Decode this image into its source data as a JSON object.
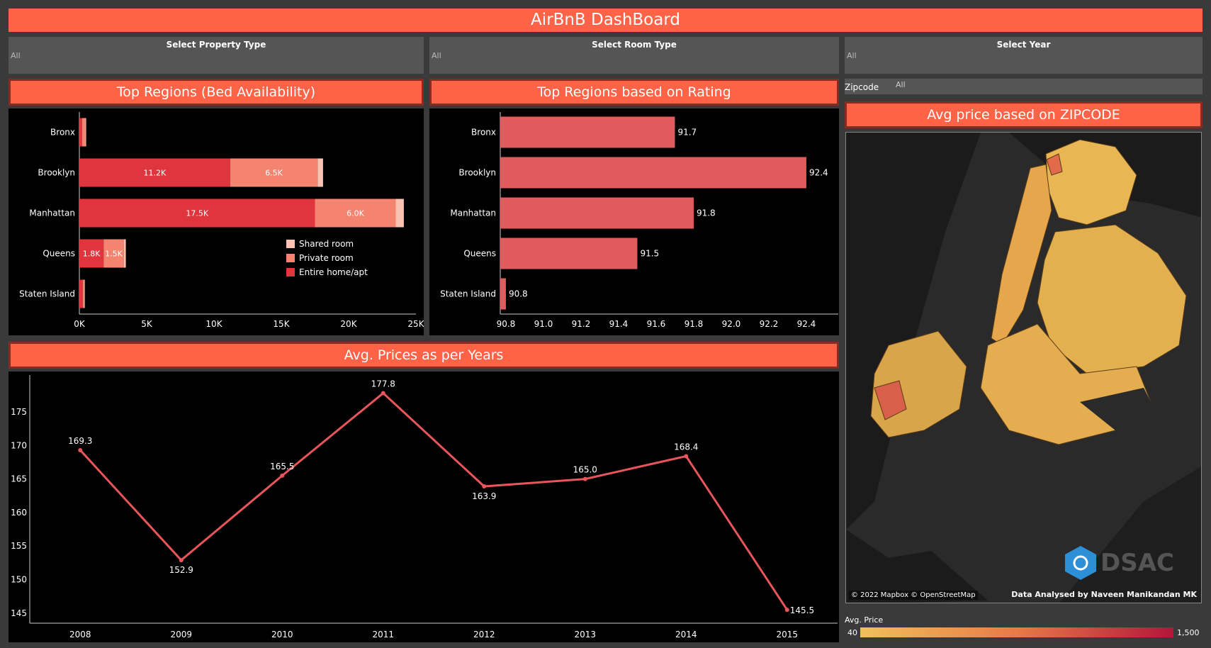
{
  "dashboard": {
    "title": "AirBnB DashBoard"
  },
  "filters": [
    {
      "label": "Select Property Type",
      "value": "All"
    },
    {
      "label": "Select Room Type",
      "value": "All"
    },
    {
      "label": "Select Year",
      "value": "All"
    }
  ],
  "zipcode_filter": {
    "label": "Zipcode",
    "value": "All"
  },
  "panels": {
    "beds": "Top Regions (Bed Availability)",
    "rating": "Top Regions based on Rating",
    "years": "Avg. Prices as per Years",
    "map": "Avg price based on ZIPCODE"
  },
  "map": {
    "attribution": "© 2022 Mapbox © OpenStreetMap",
    "credit": "Data Analysed by Naveen Manikandan MK",
    "logo_text": "DSAC",
    "legend_title": "Avg. Price",
    "legend_min": "40",
    "legend_max": "1,500",
    "colors": {
      "low": "#f0c05a",
      "high": "#b3163a",
      "water": "#2b2b2b",
      "land": "#1e1e1e"
    }
  },
  "chart_data": [
    {
      "type": "bar",
      "stacked": true,
      "orientation": "horizontal",
      "title": "Top Regions (Bed Availability)",
      "categories": [
        "Bronx",
        "Brooklyn",
        "Manhattan",
        "Queens",
        "Staten Island"
      ],
      "series": [
        {
          "name": "Entire home/apt",
          "color": "#e0353d",
          "values": [
            200,
            11200,
            17500,
            1800,
            250
          ]
        },
        {
          "name": "Private room",
          "color": "#f4836f",
          "values": [
            250,
            6500,
            6000,
            1500,
            100
          ]
        },
        {
          "name": "Shared room",
          "color": "#fcc2b1",
          "values": [
            50,
            400,
            600,
            150,
            20
          ]
        }
      ],
      "data_labels": [
        [
          "",
          "",
          ""
        ],
        [
          "11.2K",
          "6.5K",
          ""
        ],
        [
          "17.5K",
          "6.0K",
          ""
        ],
        [
          "1.8K",
          "1.5K",
          ""
        ],
        [
          "",
          "",
          ""
        ]
      ],
      "xticks": [
        "0K",
        "5K",
        "10K",
        "15K",
        "20K",
        "25K"
      ],
      "xlim": [
        0,
        25000
      ],
      "legend_position": "inside-right",
      "legend": [
        "Shared room",
        "Private room",
        "Entire home/apt"
      ]
    },
    {
      "type": "bar",
      "orientation": "horizontal",
      "title": "Top Regions based on Rating",
      "categories": [
        "Bronx",
        "Brooklyn",
        "Manhattan",
        "Queens",
        "Staten Island"
      ],
      "values": [
        91.7,
        92.4,
        91.8,
        91.5,
        90.8
      ],
      "labels": [
        "91.7",
        "92.4",
        "91.8",
        "91.5",
        "90.8"
      ],
      "color": "#e05a5e",
      "xticks": [
        "90.8",
        "91.0",
        "91.2",
        "91.4",
        "91.6",
        "91.8",
        "92.0",
        "92.2",
        "92.4"
      ],
      "xlim": [
        90.77,
        92.57
      ]
    },
    {
      "type": "line",
      "title": "Avg. Prices as per Years",
      "x": [
        "2008",
        "2009",
        "2010",
        "2011",
        "2012",
        "2013",
        "2014",
        "2015"
      ],
      "values": [
        169.3,
        152.9,
        165.5,
        177.8,
        163.9,
        165.0,
        168.4,
        145.5
      ],
      "labels": [
        "169.3",
        "152.9",
        "165.5",
        "177.8",
        "163.9",
        "165.0",
        "168.4",
        "145.5"
      ],
      "color": "#e8555a",
      "yticks": [
        "145",
        "150",
        "155",
        "160",
        "165",
        "170",
        "175"
      ],
      "ylim": [
        143.5,
        180.5
      ]
    }
  ]
}
